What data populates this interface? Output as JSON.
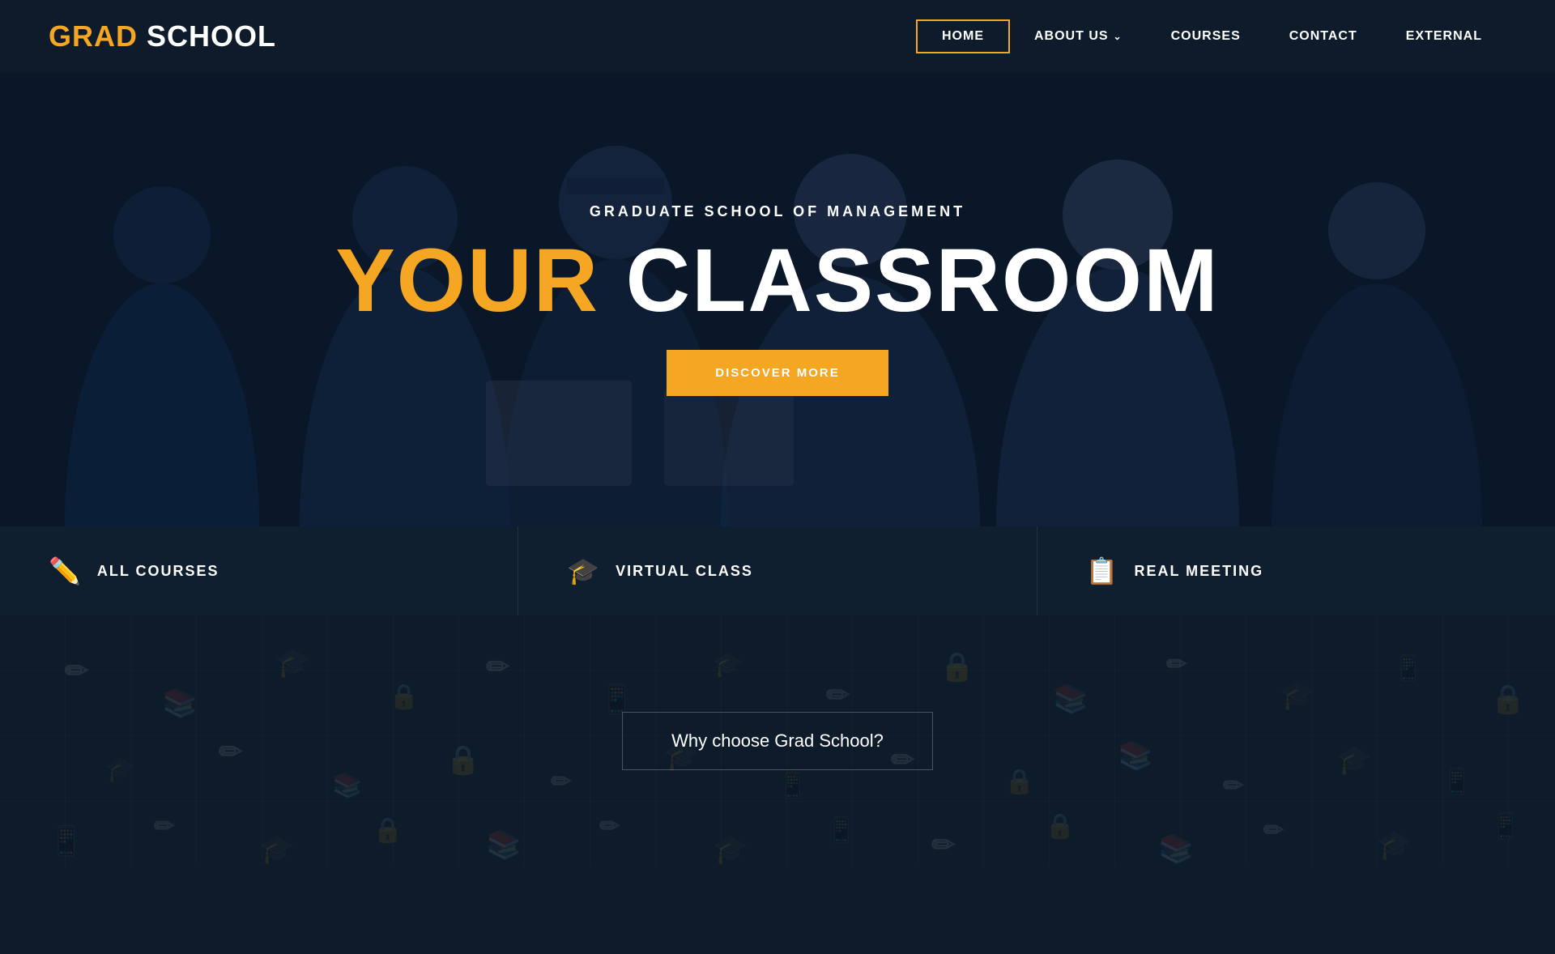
{
  "brand": {
    "grad": "GRAD",
    "school": " SCHOOL"
  },
  "nav": {
    "links": [
      {
        "id": "home",
        "label": "HOME",
        "active": true,
        "has_chevron": false
      },
      {
        "id": "about",
        "label": "ABOUT US",
        "active": false,
        "has_chevron": true
      },
      {
        "id": "courses",
        "label": "COURSES",
        "active": false,
        "has_chevron": false
      },
      {
        "id": "contact",
        "label": "CONTACT",
        "active": false,
        "has_chevron": false
      },
      {
        "id": "external",
        "label": "EXTERNAL",
        "active": false,
        "has_chevron": false
      }
    ]
  },
  "hero": {
    "subtitle": "GRADUATE SCHOOL OF MANAGEMENT",
    "title_your": "YOUR",
    "title_classroom": " CLASSROOM",
    "cta_label": "DISCOVER MORE"
  },
  "feature_cards": [
    {
      "id": "all-courses",
      "icon": "✏",
      "label": "ALL COURSES"
    },
    {
      "id": "virtual-class",
      "icon": "🎓",
      "label": "VIRTUAL CLASS"
    },
    {
      "id": "real-meeting",
      "icon": "📋",
      "label": "REAL MEETING"
    }
  ],
  "why_section": {
    "text": "Why choose Grad School?"
  },
  "colors": {
    "accent": "#f5a623",
    "dark_navy": "#0d1b2a",
    "card_bg": "#0f1f30"
  }
}
